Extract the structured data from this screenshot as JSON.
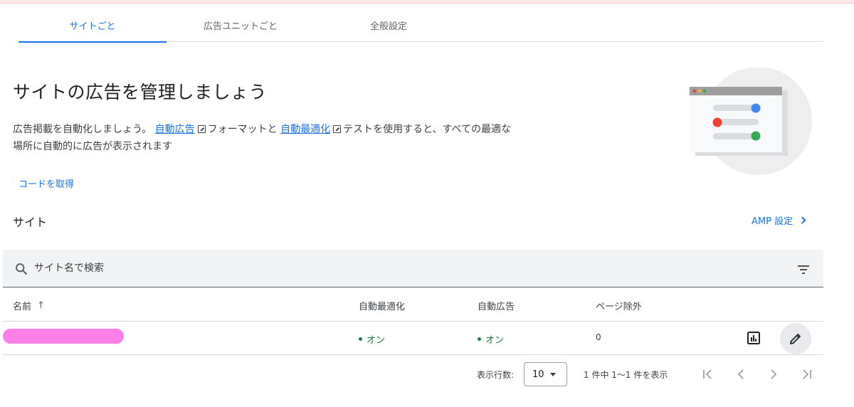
{
  "tabs": [
    {
      "label": "サイトごと",
      "active": true
    },
    {
      "label": "広告ユニットごと",
      "active": false
    },
    {
      "label": "全般設定",
      "active": false
    }
  ],
  "hero": {
    "title": "サイトの広告を管理しましょう",
    "desc_part1": "広告掲載を自動化しましょう。",
    "link_auto_ads": "自動広告",
    "desc_part2": "フォーマットと",
    "link_auto_opt": "自動最適化",
    "desc_part3": "テストを使用すると、すべての最適な場所に自動的に広告が表示されます",
    "get_code": "コードを取得"
  },
  "sites": {
    "heading": "サイト",
    "amp_settings": "AMP 設定"
  },
  "search": {
    "placeholder": "サイト名で検索"
  },
  "table": {
    "headers": {
      "name": "名前",
      "sort_indicator": "↑",
      "auto_optimize": "自動最適化",
      "auto_ads": "自動広告",
      "page_exclusions": "ページ除外"
    },
    "rows": [
      {
        "name": "",
        "auto_optimize": "オン",
        "auto_ads": "オン",
        "page_exclusions": "0"
      }
    ]
  },
  "pagination": {
    "rows_label": "表示行数:",
    "rows_value": "10",
    "range_text": "1 件中 1〜1 件を表示"
  },
  "colors": {
    "accent": "#1a73e8",
    "status_on": "#188038",
    "redaction": "#ff7fe8"
  },
  "icons": [
    "search-icon",
    "filter-icon",
    "external-link-icon",
    "chevron-right-icon",
    "report-icon",
    "edit-icon",
    "first-page-icon",
    "prev-page-icon",
    "next-page-icon",
    "last-page-icon"
  ]
}
